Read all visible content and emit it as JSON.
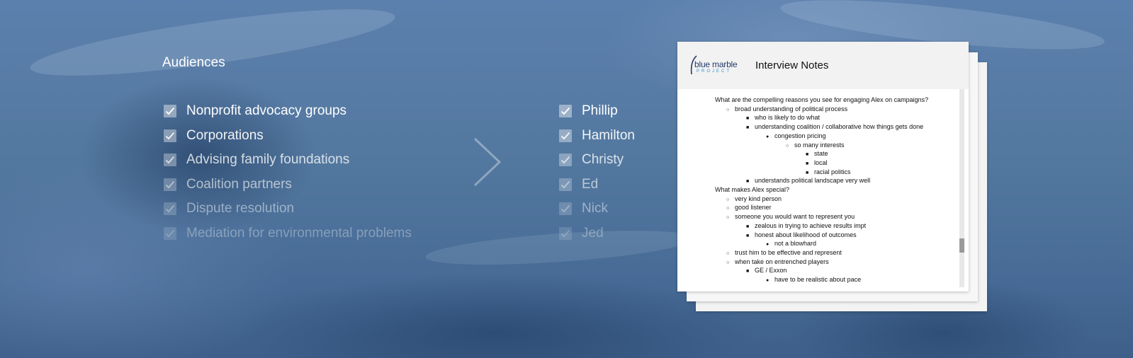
{
  "audiences": {
    "title": "Audiences",
    "items": [
      {
        "label": "Nonprofit advocacy groups",
        "opacity": 1.0,
        "checked": true
      },
      {
        "label": "Corporations",
        "opacity": 0.92,
        "checked": true
      },
      {
        "label": "Advising family foundations",
        "opacity": 0.78,
        "checked": true
      },
      {
        "label": "Coalition partners",
        "opacity": 0.6,
        "checked": true
      },
      {
        "label": "Dispute resolution",
        "opacity": 0.45,
        "checked": true
      },
      {
        "label": "Mediation for environmental problems",
        "opacity": 0.32,
        "checked": true
      }
    ]
  },
  "people": {
    "items": [
      {
        "label": "Phillip",
        "opacity": 1.0,
        "checked": true
      },
      {
        "label": "Hamilton",
        "opacity": 0.92,
        "checked": true
      },
      {
        "label": "Christy",
        "opacity": 0.78,
        "checked": true
      },
      {
        "label": "Ed",
        "opacity": 0.6,
        "checked": true
      },
      {
        "label": "Nick",
        "opacity": 0.45,
        "checked": true
      },
      {
        "label": "Jed",
        "opacity": 0.32,
        "checked": true
      }
    ]
  },
  "document": {
    "logo_line1": "blue marble",
    "logo_line2": "PROJECT",
    "title": "Interview Notes",
    "lines": [
      {
        "level": 0,
        "bullet": "",
        "text": "What are the compelling reasons you see for engaging Alex on campaigns?"
      },
      {
        "level": 1,
        "bullet": "○",
        "text": "broad understanding of political process"
      },
      {
        "level": 2,
        "bullet": "■",
        "text": "who is likely to do what"
      },
      {
        "level": 2,
        "bullet": "■",
        "text": "understanding coalition / collaborative how things gets done"
      },
      {
        "level": 3,
        "bullet": "●",
        "text": "congestion pricing"
      },
      {
        "level": 4,
        "bullet": "○",
        "text": "so many interests"
      },
      {
        "level": 5,
        "bullet": "■",
        "text": "state"
      },
      {
        "level": 5,
        "bullet": "■",
        "text": "local"
      },
      {
        "level": 5,
        "bullet": "■",
        "text": "racial politics"
      },
      {
        "level": 2,
        "bullet": "■",
        "text": "understands political landscape very well"
      },
      {
        "level": 0,
        "bullet": "",
        "text": "What makes Alex special?"
      },
      {
        "level": 1,
        "bullet": "○",
        "text": "very kind person"
      },
      {
        "level": 1,
        "bullet": "○",
        "text": "good listener"
      },
      {
        "level": 1,
        "bullet": "○",
        "text": "someone you would want to represent you"
      },
      {
        "level": 2,
        "bullet": "■",
        "text": "zealous in trying to achieve results impt"
      },
      {
        "level": 2,
        "bullet": "■",
        "text": "honest about likelihood of outcomes"
      },
      {
        "level": 3,
        "bullet": "●",
        "text": "not a blowhard"
      },
      {
        "level": 1,
        "bullet": "○",
        "text": "trust him to be effective and represent"
      },
      {
        "level": 1,
        "bullet": "○",
        "text": "when take on entrenched players"
      },
      {
        "level": 2,
        "bullet": "■",
        "text": "GE / Exxon"
      },
      {
        "level": 3,
        "bullet": "●",
        "text": "have to be realistic about pace"
      }
    ]
  },
  "icons": {
    "checkbox": "checkmark-icon",
    "arrow": "chevron-right-icon",
    "scrollbar": "scrollbar"
  },
  "colors": {
    "background": "#4f74a0",
    "checkbox_fill": "rgba(255,255,255,0.42)",
    "logo_primary": "#233b6b",
    "logo_accent": "#2b8fcf"
  }
}
